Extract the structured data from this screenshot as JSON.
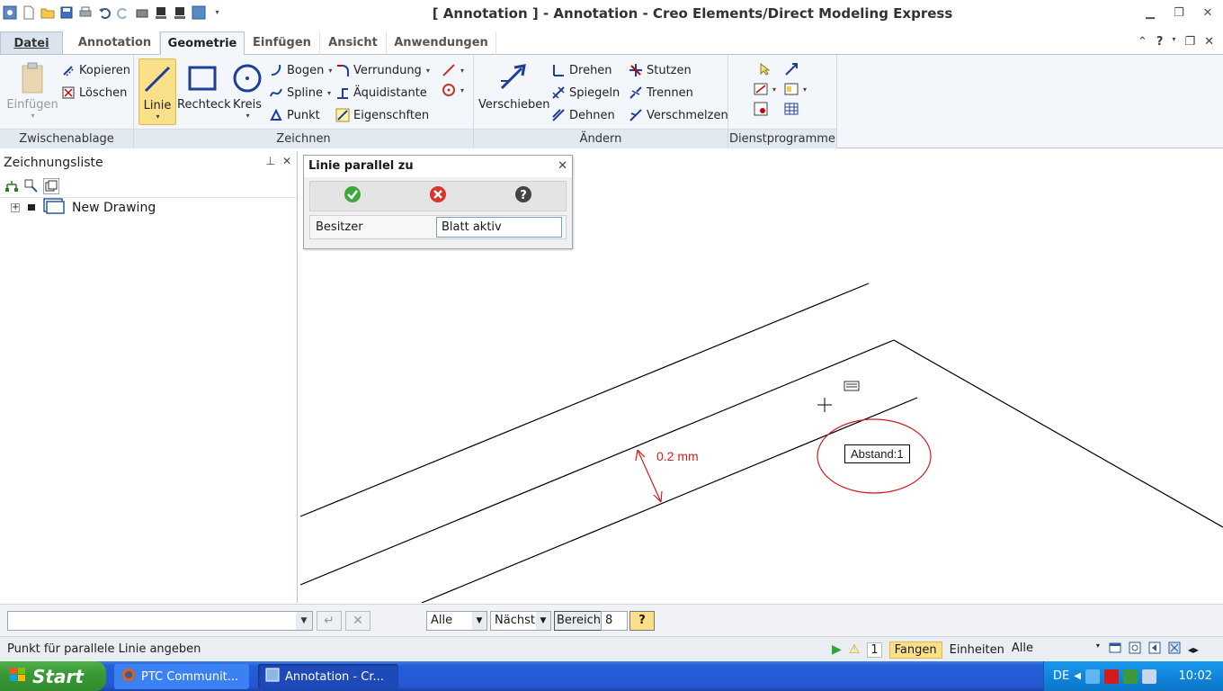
{
  "window": {
    "title": "[ Annotation ] - Annotation - Creo Elements/Direct Modeling Express"
  },
  "tabs": [
    {
      "label": "Datei"
    },
    {
      "label": "Annotation"
    },
    {
      "label": "Geometrie"
    },
    {
      "label": "Einfügen"
    },
    {
      "label": "Ansicht"
    },
    {
      "label": "Anwendungen"
    }
  ],
  "ribbon": {
    "clipboard": {
      "group_label": "Zwischenablage",
      "paste": "Einfügen",
      "copy": "Kopieren",
      "delete": "Löschen"
    },
    "draw": {
      "group_label": "Zeichnen",
      "line": "Linie",
      "rectangle": "Rechteck",
      "circle": "Kreis",
      "arc": "Bogen",
      "spline": "Spline",
      "point": "Punkt",
      "fillet": "Verrundung",
      "offset": "Äquidistante",
      "properties": "Eigenschften"
    },
    "modify": {
      "group_label": "Ändern",
      "move": "Verschieben",
      "rotate": "Drehen",
      "mirror": "Spiegeln",
      "stretch": "Dehnen",
      "trim": "Stutzen",
      "split": "Trennen",
      "merge": "Verschmelzen"
    },
    "utilities": {
      "group_label": "Dienstprogramme"
    }
  },
  "left_panel": {
    "title": "Zeichnungsliste",
    "tree_item": "New Drawing"
  },
  "dialog": {
    "title": "Linie parallel zu",
    "owner_label": "Besitzer",
    "owner_value": "Blatt aktiv"
  },
  "canvas": {
    "dimension_label": "0.2 mm",
    "tooltip": "Abstand:1"
  },
  "command_bar": {
    "filter_all": "Alle",
    "nearest": "Nächst",
    "range": "Bereich",
    "range_value": "8"
  },
  "status_bar": {
    "message": "Punkt für parallele Linie angeben",
    "count": "1",
    "snap": "Fangen",
    "units": "Einheiten",
    "units_select": "Alle"
  },
  "taskbar": {
    "start": "Start",
    "task1": "PTC Communit...",
    "task2": "Annotation - Cr...",
    "lang": "DE",
    "clock": "10:02"
  },
  "colors": {
    "accent_selected": "#fbe08a",
    "dimension_red": "#d11c1c",
    "taskbar_blue": "#245edb",
    "start_green": "#3a9a36"
  }
}
